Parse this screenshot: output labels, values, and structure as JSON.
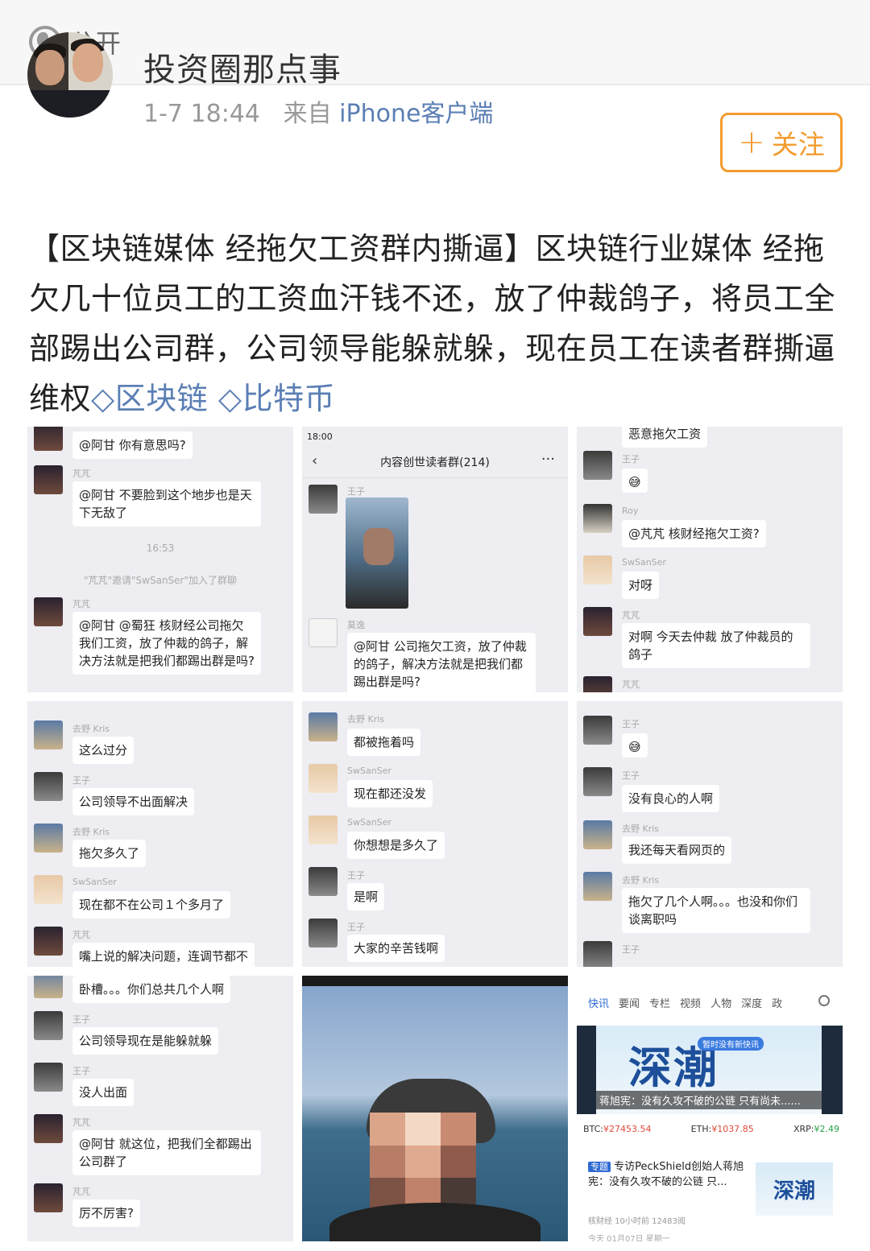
{
  "topbar": {
    "visibility": "公开",
    "icon": "globe-icon"
  },
  "post": {
    "author": "投资圈那点事",
    "time": "1-7 18:44",
    "from_label": "来自",
    "source": "iPhone客户端",
    "follow_label": "关注",
    "text_main": "【区块链媒体     经拖欠工资群内撕逼】区块链行业媒体    经拖欠几十位员工的工资血汗钱不还，放了仲裁鸽子，将员工全部踢出公司群，公司领导能躲就躲，现在员工在读者群撕逼维权",
    "topics": [
      "区块链",
      "比特币"
    ]
  },
  "images": {
    "img1": {
      "messages": [
        {
          "nick": "",
          "text": "@阿甘  你有意思吗?"
        },
        {
          "nick": "芃芃",
          "text": "@阿甘  不要脸到这个地步也是天下无敌了"
        },
        {
          "sys_time": "16:53"
        },
        {
          "sys": "\"芃芃\"邀请\"SwSanSer\"加入了群聊"
        },
        {
          "nick": "芃芃",
          "text": "@阿甘 @蜀狂  核财经公司拖欠我们工资，放了仲裁的鸽子，解决方法就是把我们都踢出群是吗?"
        }
      ]
    },
    "img2": {
      "status_time": "18:00",
      "chat_title": "内容创世读者群(214)",
      "messages": [
        {
          "nick": "王子"
        },
        {
          "nick": "莫逸",
          "text": "@阿甘  公司拖欠工资，放了仲裁的鸽子，解决方法就是把我们都踢出群是吗?"
        }
      ]
    },
    "img3": {
      "messages": [
        {
          "text": "恶意拖欠工资"
        },
        {
          "nick": "王子"
        },
        {
          "nick": "Roy",
          "text": "@芃芃  核财经拖欠工资?"
        },
        {
          "nick": "SwSanSer",
          "text": "对呀"
        },
        {
          "nick": "芃芃",
          "text": "对啊 今天去仲裁 放了仲裁员的鸽子"
        },
        {
          "nick": "芃芃"
        }
      ]
    },
    "img4": {
      "messages": [
        {
          "nick": "去野 Kris",
          "text": "这么过分"
        },
        {
          "nick": "王子",
          "text": "公司领导不出面解决"
        },
        {
          "nick": "去野 Kris",
          "text": "拖欠多久了"
        },
        {
          "nick": "SwSanSer",
          "text": "现在都不在公司１个多月了"
        },
        {
          "nick": "芃芃",
          "text": "嘴上说的解决问题，连调节都不"
        }
      ]
    },
    "img5": {
      "messages": [
        {
          "nick": "去野 Kris",
          "text": "都被拖着吗"
        },
        {
          "nick": "SwSanSer",
          "text": "现在都还没发"
        },
        {
          "nick": "SwSanSer",
          "text": "你想想是多久了"
        },
        {
          "nick": "王子",
          "text": "是啊"
        },
        {
          "nick": "王子",
          "text": "大家的辛苦钱啊"
        }
      ]
    },
    "img6": {
      "messages": [
        {
          "nick": "王子"
        },
        {
          "nick": "王子",
          "text": "没有良心的人啊"
        },
        {
          "nick": "去野 Kris",
          "text": "我还每天看网页的"
        },
        {
          "nick": "去野 Kris",
          "text": "拖欠了几个人啊。。。也没和你们谈离职吗"
        },
        {
          "nick": "王子"
        }
      ]
    },
    "img7": {
      "messages": [
        {
          "text": "卧槽。。。你们总共几个人啊"
        },
        {
          "nick": "王子",
          "text": "公司领导现在是能躲就躲"
        },
        {
          "nick": "王子",
          "text": "没人出面"
        },
        {
          "nick": "芃芃",
          "text": "@阿甘  就这位，把我们全都踢出公司群了"
        },
        {
          "nick": "芃芃",
          "text": "厉不厉害?"
        }
      ]
    },
    "img9": {
      "tabs": [
        "快讯",
        "要闻",
        "专栏",
        "视频",
        "人物",
        "深度",
        "政"
      ],
      "pill": "暂时没有新快讯",
      "logo": "深潮",
      "headline": "蒋旭宪：没有久攻不破的公链 只有尚未......",
      "prices": [
        {
          "label": "BTC:",
          "value": "¥27453.54"
        },
        {
          "label": "ETH:",
          "value": "¥1037.85"
        },
        {
          "label": "XRP:",
          "value": "¥2.49"
        }
      ],
      "tag": "专题",
      "article": "专访PeckShield创始人蒋旭宪：没有久攻不破的公链 只...",
      "meta": "核财经  10小时前  12483阅",
      "footer": "今天 01月07日 星期一"
    }
  },
  "colors": {
    "link": "#5b7fb4",
    "follow": "#f39c30",
    "chat_bg": "#ededf2"
  }
}
